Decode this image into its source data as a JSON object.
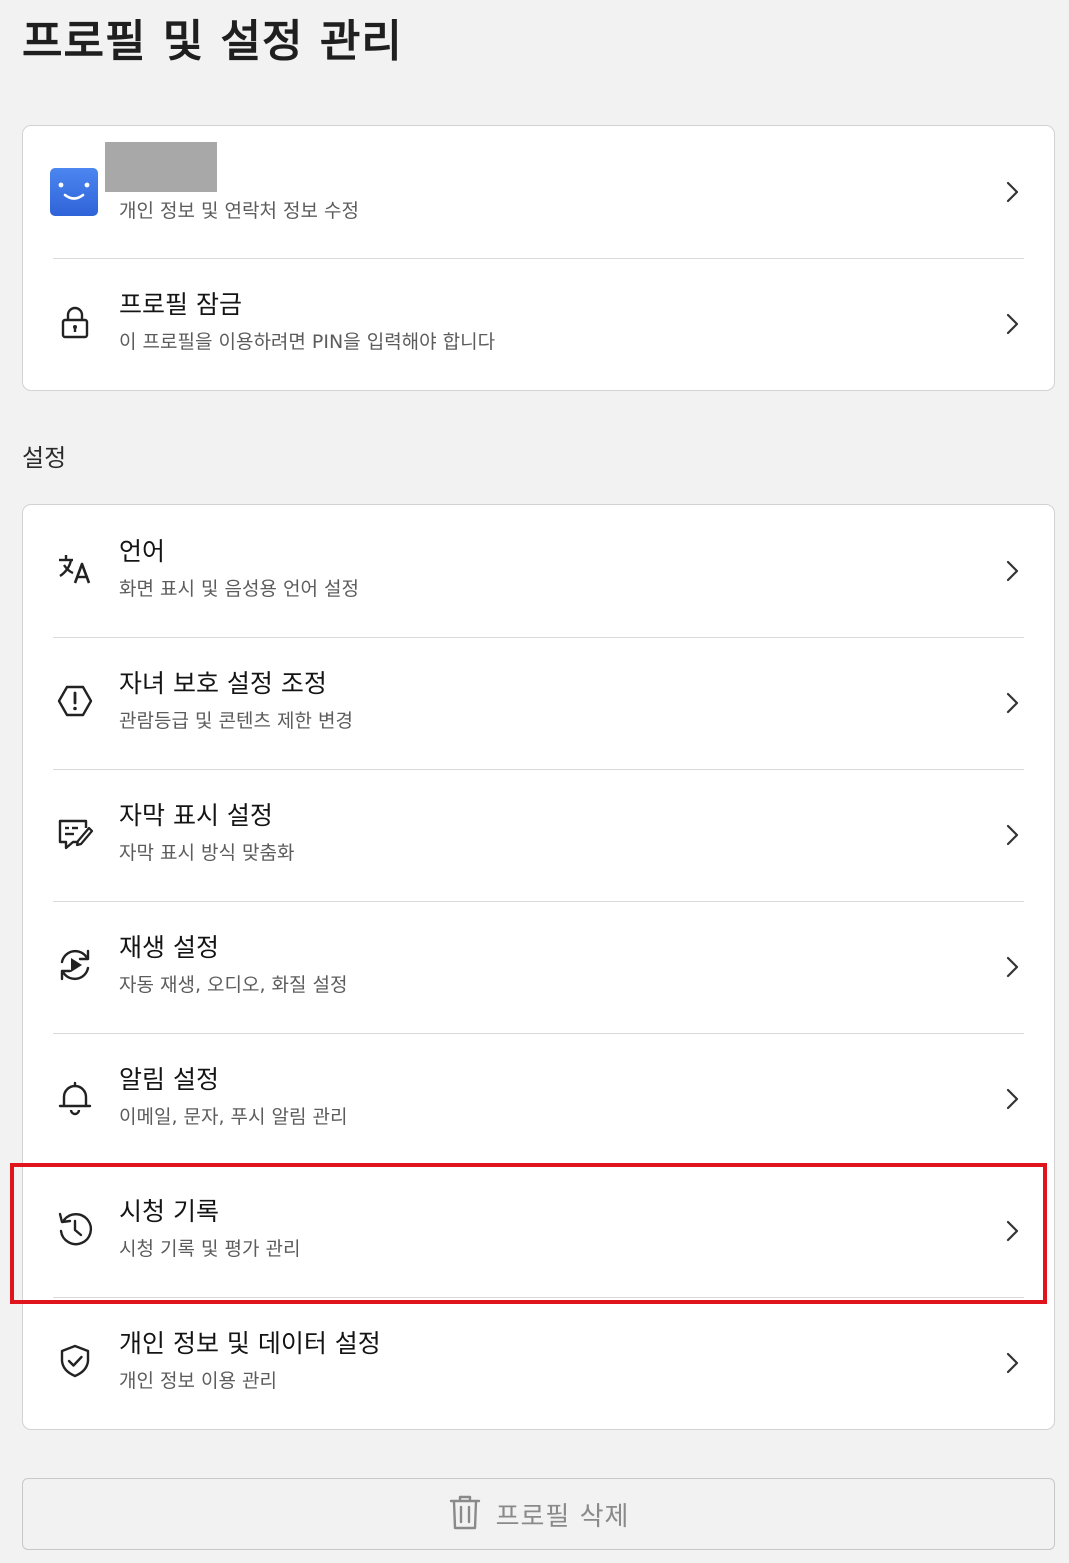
{
  "page": {
    "title": "프로필 및 설정 관리"
  },
  "profile_card": {
    "account": {
      "subtitle": "개인 정보 및 연락처 정보 수정",
      "icon": "smiley-avatar-icon"
    },
    "lock": {
      "title": "프로필 잠금",
      "subtitle": "이 프로필을 이용하려면 PIN을 입력해야 합니다",
      "icon": "lock-icon"
    }
  },
  "settings": {
    "section_label": "설정",
    "items": [
      {
        "title": "언어",
        "subtitle": "화면 표시 및 음성용 언어 설정",
        "icon": "translate-icon"
      },
      {
        "title": "자녀 보호 설정 조정",
        "subtitle": "관람등급 및 콘텐츠 제한 변경",
        "icon": "warning-hexagon-icon"
      },
      {
        "title": "자막 표시 설정",
        "subtitle": "자막 표시 방식 맞춤화",
        "icon": "subtitle-edit-icon"
      },
      {
        "title": "재생 설정",
        "subtitle": "자동 재생, 오디오, 화질 설정",
        "icon": "autoplay-icon"
      },
      {
        "title": "알림 설정",
        "subtitle": "이메일, 문자, 푸시 알림 관리",
        "icon": "bell-icon"
      },
      {
        "title": "시청 기록",
        "subtitle": "시청 기록 및 평가 관리",
        "icon": "history-icon"
      },
      {
        "title": "개인 정보 및 데이터 설정",
        "subtitle": "개인 정보 이용 관리",
        "icon": "shield-check-icon"
      }
    ]
  },
  "delete_button": {
    "label": "프로필 삭제",
    "icon": "trash-icon"
  },
  "colors": {
    "highlight": "#e0141c",
    "avatar": "#3a72e4"
  }
}
